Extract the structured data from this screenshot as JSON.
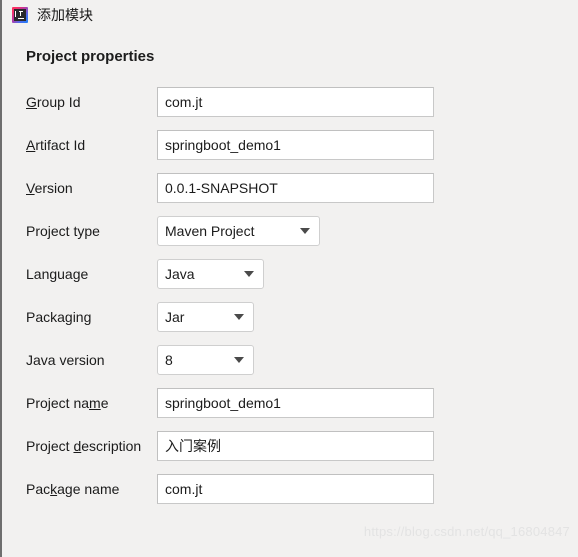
{
  "window": {
    "title": "添加模块",
    "icon": "intellij-idea-logo-icon",
    "background_color": "#f2f1f0",
    "border_color": "#6e6e6e"
  },
  "section": {
    "title": "Project properties"
  },
  "form": {
    "rows": [
      {
        "label_prefix": "",
        "label_mnemonic": "G",
        "label_suffix": "roup Id",
        "control": "textfield",
        "value": "com.jt",
        "name": "group-id"
      },
      {
        "label_prefix": "",
        "label_mnemonic": "A",
        "label_suffix": "rtifact Id",
        "control": "textfield",
        "value": "springboot_demo1",
        "name": "artifact-id"
      },
      {
        "label_prefix": "",
        "label_mnemonic": "V",
        "label_suffix": "ersion",
        "control": "textfield",
        "value": "0.0.1-SNAPSHOT",
        "name": "version"
      },
      {
        "label_prefix": "Project type",
        "label_mnemonic": "",
        "label_suffix": "",
        "control": "combo",
        "value": "Maven Project",
        "name": "project-type",
        "width_class": "combo-w-maven"
      },
      {
        "label_prefix": "Language",
        "label_mnemonic": "",
        "label_suffix": "",
        "control": "combo",
        "value": "Java",
        "name": "language",
        "width_class": "combo-w-lang"
      },
      {
        "label_prefix": "Packaging",
        "label_mnemonic": "",
        "label_suffix": "",
        "control": "combo",
        "value": "Jar",
        "name": "packaging",
        "width_class": "combo-w-pack"
      },
      {
        "label_prefix": "Java version",
        "label_mnemonic": "",
        "label_suffix": "",
        "control": "combo",
        "value": "8",
        "name": "java-version",
        "width_class": "combo-w-jv"
      },
      {
        "label_prefix": "Project na",
        "label_mnemonic": "m",
        "label_suffix": "e",
        "control": "textfield",
        "value": "springboot_demo1",
        "name": "project-name"
      },
      {
        "label_prefix": "Project ",
        "label_mnemonic": "d",
        "label_suffix": "escription",
        "control": "textfield",
        "value": "入门案例",
        "name": "project-description"
      },
      {
        "label_prefix": "Pac",
        "label_mnemonic": "k",
        "label_suffix": "age name",
        "control": "textfield",
        "value": "com.jt",
        "name": "package-name"
      }
    ]
  },
  "watermark": {
    "text": "https://blog.csdn.net/qq_16804847"
  }
}
